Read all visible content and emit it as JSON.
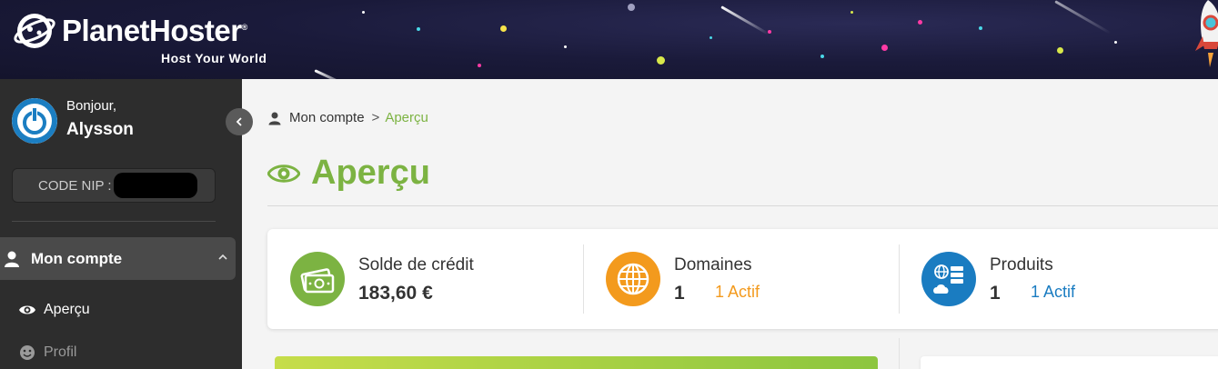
{
  "header": {
    "brand": "PlanetHoster",
    "brand_mark": "®",
    "tagline": "Host Your World"
  },
  "sidebar": {
    "greeting": "Bonjour,",
    "username": "Alysson",
    "nip_label": "CODE NIP :",
    "menu": {
      "parent_label": "Mon compte",
      "items": [
        {
          "label": "Aperçu",
          "icon": "eye-icon"
        },
        {
          "label": "Profil",
          "icon": "smiley-icon"
        }
      ]
    }
  },
  "main": {
    "breadcrumb": {
      "root": "Mon compte",
      "separator": ">",
      "current": "Aperçu"
    },
    "title": "Aperçu",
    "stats": [
      {
        "label": "Solde de crédit",
        "value": "183,60 €",
        "active": "",
        "icon": "money-icon",
        "color": "#7cb342"
      },
      {
        "label": "Domaines",
        "value": "1",
        "active": "1 Actif",
        "icon": "globe-icon",
        "color": "#f39a1d"
      },
      {
        "label": "Produits",
        "value": "1",
        "active": "1 Actif",
        "icon": "cloud-server-icon",
        "color": "#1a7cc1"
      }
    ]
  },
  "colors": {
    "accent_green": "#7cb342",
    "sidebar_bg": "#2d2d2d",
    "orange": "#f39a1d",
    "blue": "#1a7cc1"
  }
}
